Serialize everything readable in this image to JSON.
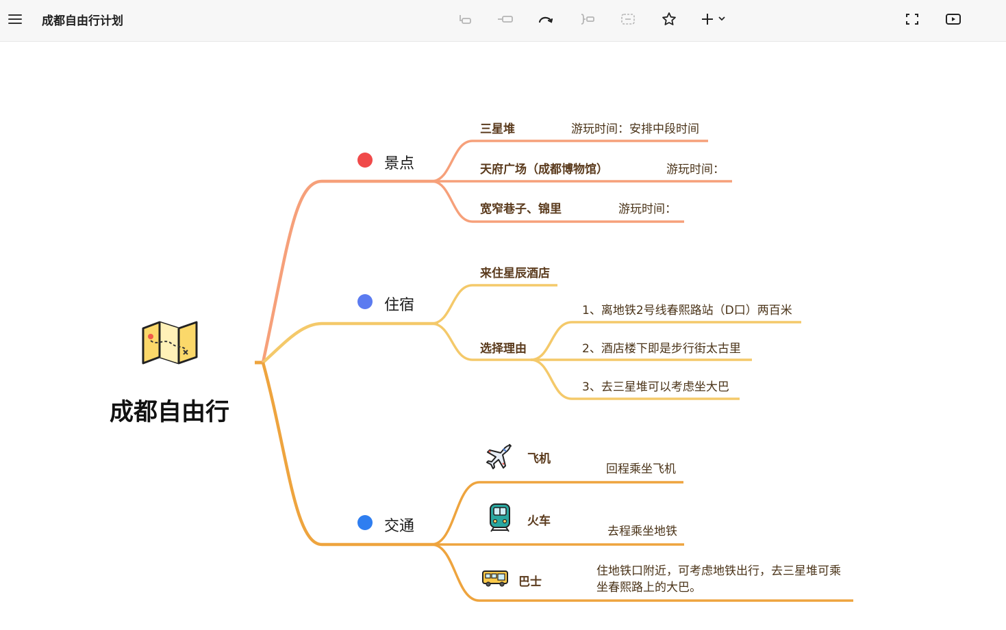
{
  "toolbar": {
    "menu_icon": "hamburger-menu-icon",
    "title": "成都自由行计划",
    "tools": [
      "insert-parent-icon",
      "insert-sibling-icon",
      "relation-curve-icon",
      "summary-icon",
      "boundary-icon",
      "star-icon",
      "add-icon"
    ],
    "right_tools": [
      "fullscreen-icon",
      "presentation-play-icon"
    ]
  },
  "colors": {
    "branch_sights": "#f6a07a",
    "branch_stay": "#f4c96a",
    "branch_transport": "#eea43e",
    "dot_sights": "#f04a4a",
    "dot_stay": "#5b7bf0",
    "dot_transport": "#2f7ef0"
  },
  "root": {
    "icon": "folded-map-icon",
    "title": "成都自由行"
  },
  "branches": {
    "sights": {
      "label": "景点",
      "items": [
        {
          "name": "三星堆",
          "note": "游玩时间：安排中段时间"
        },
        {
          "name": "天府广场（成都博物馆）",
          "note": "游玩时间："
        },
        {
          "name": "宽窄巷子、锦里",
          "note": "游玩时间："
        }
      ]
    },
    "stay": {
      "label": "住宿",
      "hotel": "来住星辰酒店",
      "reason_label": "选择理由",
      "reasons": [
        "1、离地铁2号线春熙路站（D口）两百米",
        "2、酒店楼下即是步行街太古里",
        "3、去三星堆可以考虑坐大巴"
      ]
    },
    "transport": {
      "label": "交通",
      "items": [
        {
          "icon": "airplane-icon",
          "name": "飞机",
          "note": "回程乘坐飞机"
        },
        {
          "icon": "train-icon",
          "name": "火车",
          "note": "去程乘坐地铁"
        },
        {
          "icon": "bus-icon",
          "name": "巴士",
          "note_line1": "住地铁口附近，可考虑地铁出行，去三星堆可乘",
          "note_line2": "坐春熙路上的大巴。"
        }
      ]
    }
  }
}
